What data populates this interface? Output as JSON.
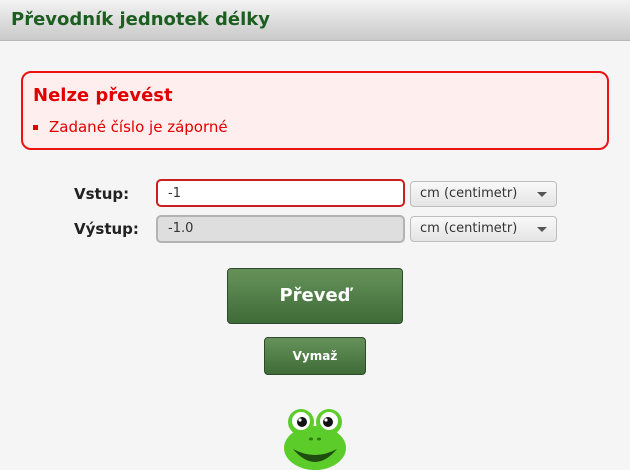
{
  "app": {
    "title": "Převodník jednotek délky"
  },
  "error": {
    "title": "Nelze převést",
    "messages": [
      "Zadané číslo je záporné"
    ]
  },
  "form": {
    "input_label": "Vstup:",
    "input_value": "-1",
    "input_unit": "cm (centimetr)",
    "output_label": "Výstup:",
    "output_value": "-1.0",
    "output_unit": "cm (centimetr)"
  },
  "buttons": {
    "convert": "Převeď",
    "clear": "Vymaž"
  },
  "colors": {
    "title_green": "#1b5e20",
    "error_red": "#e00000",
    "error_bg": "#ffeeee",
    "button_green": "#4f7a45",
    "frog_green": "#5ccc2a"
  },
  "icons": {
    "mascot": "frog-icon"
  }
}
